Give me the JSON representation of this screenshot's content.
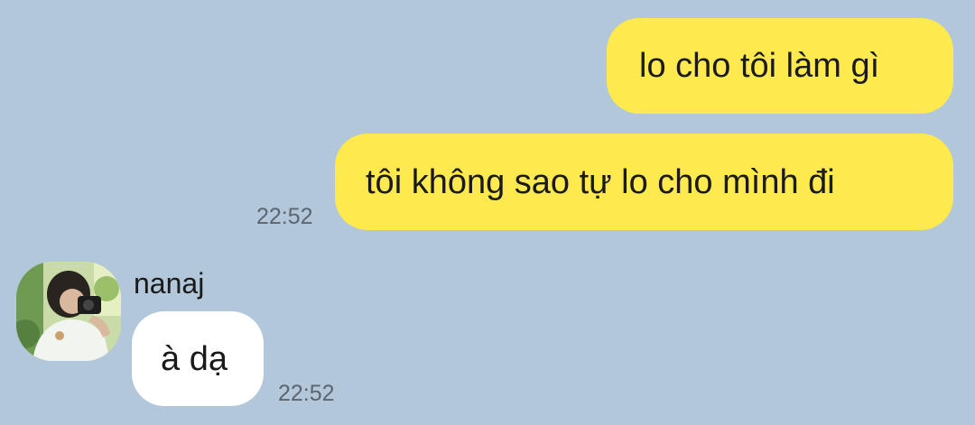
{
  "colors": {
    "background": "#b2c7d9",
    "outgoing_bubble": "#fee94f",
    "incoming_bubble": "#ffffff",
    "timestamp": "#5b6670"
  },
  "messages": {
    "outgoing": [
      {
        "text": "lo cho tôi làm gì"
      },
      {
        "text": "tôi không sao tự lo cho mình đi",
        "time": "22:52"
      }
    ],
    "incoming": [
      {
        "sender": "nanaj",
        "text": "à dạ",
        "time": "22:52",
        "avatar_icon": "profile-photo"
      }
    ]
  }
}
